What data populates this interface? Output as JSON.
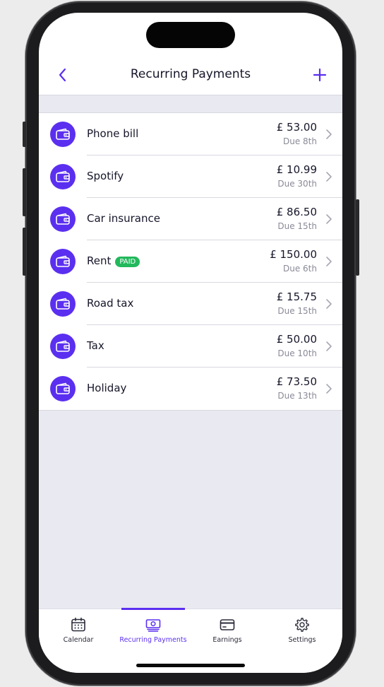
{
  "header": {
    "title": "Recurring Payments",
    "back_icon": "chevron-left-icon",
    "add_icon": "plus-icon"
  },
  "payments": [
    {
      "name": "Phone bill",
      "amount": "£ 53.00",
      "due": "Due 8th",
      "paid": false
    },
    {
      "name": "Spotify",
      "amount": "£ 10.99",
      "due": "Due 30th",
      "paid": false
    },
    {
      "name": "Car insurance",
      "amount": "£ 86.50",
      "due": "Due 15th",
      "paid": false
    },
    {
      "name": "Rent",
      "amount": "£ 150.00",
      "due": "Due 6th",
      "paid": true,
      "badge": "PAID"
    },
    {
      "name": "Road tax",
      "amount": "£ 15.75",
      "due": "Due 15th",
      "paid": false
    },
    {
      "name": "Tax",
      "amount": "£ 50.00",
      "due": "Due 10th",
      "paid": false
    },
    {
      "name": "Holiday",
      "amount": "£ 73.50",
      "due": "Due 13th",
      "paid": false
    }
  ],
  "tabs": [
    {
      "label": "Calendar",
      "icon": "calendar-icon",
      "active": false
    },
    {
      "label": "Recurring Payments",
      "icon": "banknote-icon",
      "active": true
    },
    {
      "label": "Earnings",
      "icon": "credit-card-icon",
      "active": false
    },
    {
      "label": "Settings",
      "icon": "gear-icon",
      "active": false
    }
  ],
  "colors": {
    "accent": "#5b2ff0",
    "paid_badge": "#22b85c",
    "background": "#e9e9f1"
  }
}
